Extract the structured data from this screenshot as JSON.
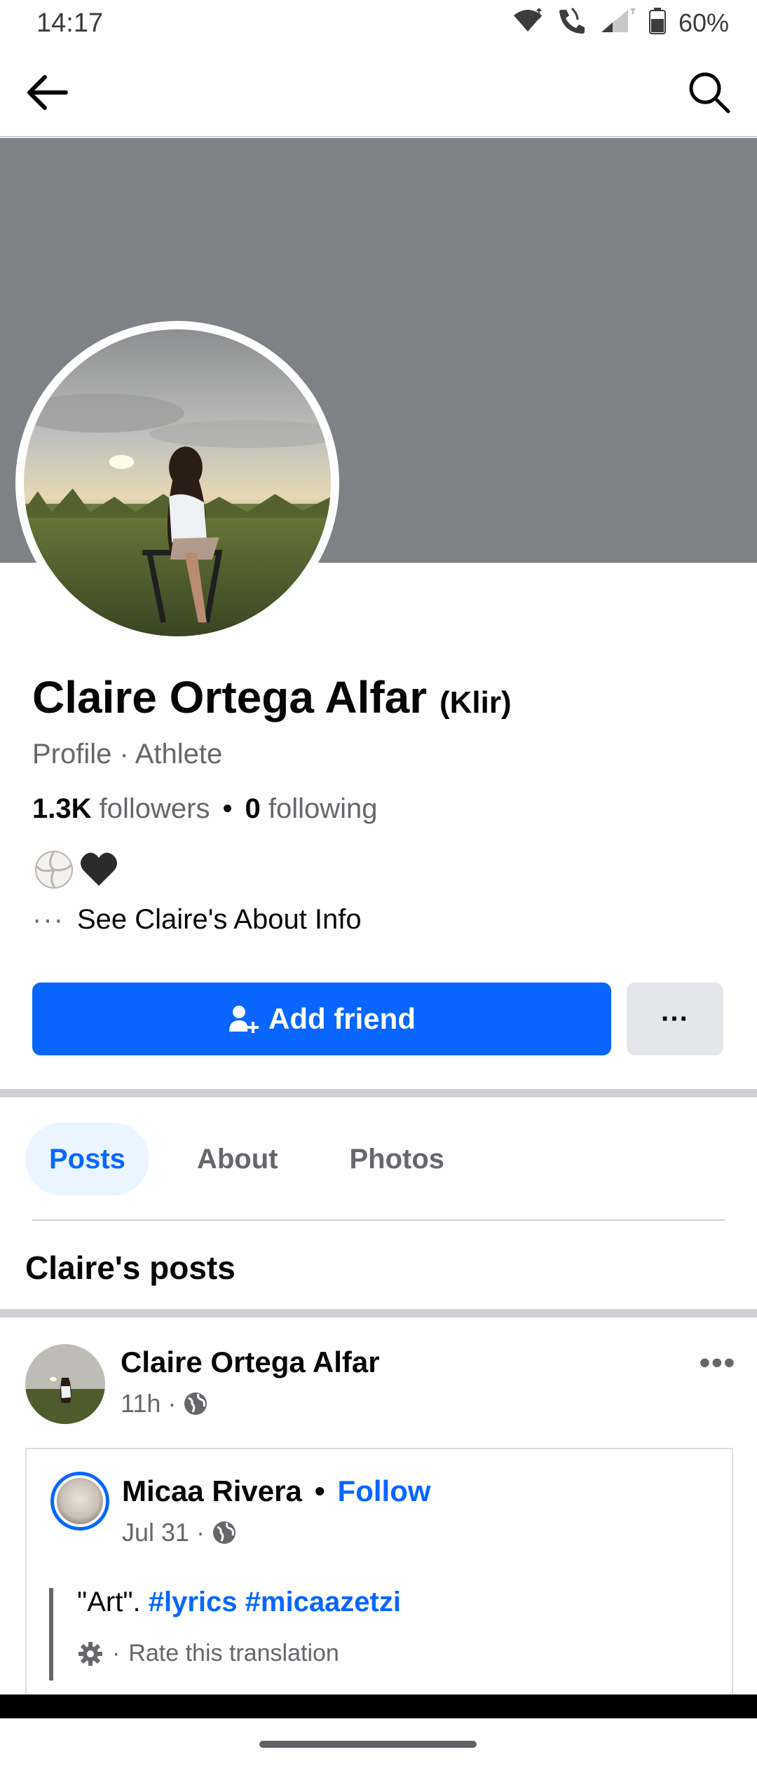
{
  "status_bar": {
    "time": "14:17",
    "battery": "60%",
    "icons": [
      "wifi-icon",
      "call-icon",
      "signal-icon",
      "battery-icon"
    ]
  },
  "topnav": {
    "back_icon": "arrow-left-icon",
    "search_icon": "search-icon"
  },
  "profile": {
    "name": "Claire Ortega Alfar",
    "nickname": "(Klir)",
    "category": "Profile · Athlete",
    "followers_count": "1.3K",
    "followers_label": "followers",
    "following_count": "0",
    "following_label": "following",
    "stats_separator": "•",
    "bio_emoji": [
      "volleyball-icon",
      "black-heart-icon"
    ],
    "about_link": "See Claire's About Info",
    "about_dots": "···"
  },
  "actions": {
    "add_friend_label": "Add friend",
    "more_label": "···"
  },
  "tabs": [
    {
      "label": "Posts",
      "active": true
    },
    {
      "label": "About",
      "active": false
    },
    {
      "label": "Photos",
      "active": false
    }
  ],
  "posts_heading": "Claire's posts",
  "post": {
    "author": "Claire Ortega Alfar",
    "time": "11h",
    "meta_sep": "·",
    "more": "•••",
    "shared": {
      "author": "Micaa Rivera",
      "sep": "•",
      "follow_label": "Follow",
      "date": "Jul 31",
      "meta_sep": "·",
      "text_quote": "\"Art\".",
      "tags": "#lyrics #micaazetzi",
      "translate_sep": "·",
      "translate_label": "Rate this translation"
    }
  },
  "colors": {
    "accent": "#0866ff",
    "cover": "#7e8286",
    "secondary_text": "#65676b"
  }
}
